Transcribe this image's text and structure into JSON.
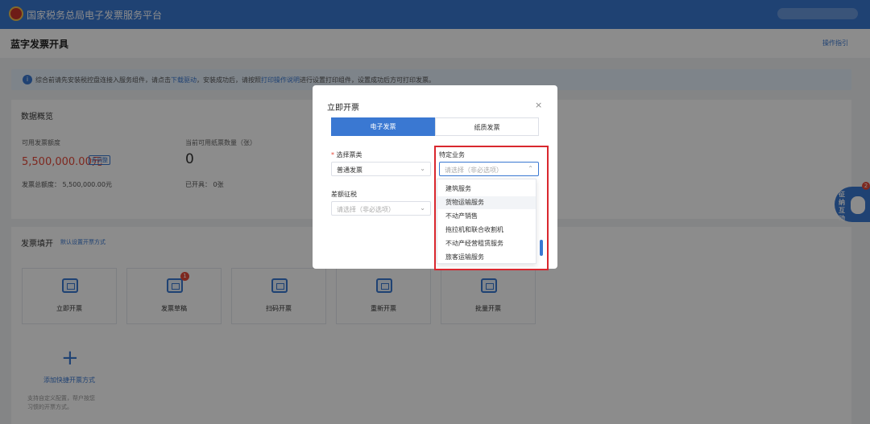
{
  "app": {
    "title": "国家税务总局电子发票服务平台"
  },
  "page": {
    "title": "蓝字发票开具",
    "guide_link": "操作指引"
  },
  "notice": {
    "text_1": "综合前请先安装税控盘连接入服务组件，请点击",
    "link_1": "下载驱动",
    "text_2": "，安装成功后，请按照",
    "link_2": "打印操作说明",
    "text_3": "进行设置打印组件，设置成功后方可打印发票。"
  },
  "overview": {
    "title": "数据概览",
    "quota_label": "可用发票额度",
    "quota_amount": "5,500,000.00元",
    "quota_tag": "去调整",
    "paper_label": "当前可用纸票数量（张）",
    "paper_count": "0",
    "total_quota": "发票总额度： 5,500,000.00元",
    "issued": "已开具： 0张"
  },
  "fill": {
    "title": "发票填开",
    "link": "默认设置开票方式",
    "tiles": [
      {
        "label": "立即开票"
      },
      {
        "label": "发票草稿",
        "badge": "1"
      },
      {
        "label": "扫码开票"
      },
      {
        "label": "重新开票"
      },
      {
        "label": "批量开票"
      }
    ],
    "add": {
      "plus": "+",
      "label": "添加快捷开票方式",
      "desc_1": "支持自定义配置，帮户按您",
      "desc_2": "习惯的开票方式。"
    }
  },
  "helper": {
    "text": "征纳互动",
    "badge": "2"
  },
  "modal": {
    "title": "立即开票",
    "close": "×",
    "tab_electronic": "电子发票",
    "tab_paper": "纸质发票",
    "invoice_type": {
      "required_mark": "*",
      "label": "选择票类",
      "value": "普通发票",
      "arrow": "⌄"
    },
    "special_business": {
      "label": "特定业务",
      "placeholder": "请选择（非必选项）",
      "arrow": "⌃",
      "options": [
        "建筑服务",
        "货物运输服务",
        "不动产销售",
        "拖拉机和联合收割机",
        "不动产经营租赁服务",
        "旅客运输服务"
      ],
      "hovered_index": 1
    },
    "reduced_tax": {
      "label": "差额征税",
      "placeholder": "请选择（非必选项）",
      "arrow": "⌄"
    }
  },
  "colors": {
    "primary": "#3a78d2",
    "highlight_border": "#d9272e",
    "amount": "#e5493a"
  }
}
